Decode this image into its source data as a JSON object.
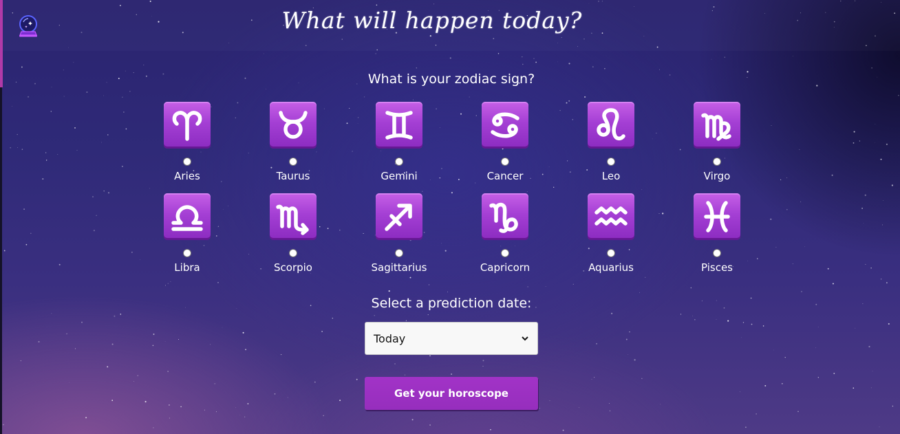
{
  "header": {
    "title": "What will happen today?",
    "logo_icon": "crystal-ball-icon"
  },
  "zodiac": {
    "question": "What is your zodiac sign?",
    "signs": [
      {
        "label": "Aries",
        "icon": "aries-icon",
        "glyph": "aries"
      },
      {
        "label": "Taurus",
        "icon": "taurus-icon",
        "glyph": "taurus"
      },
      {
        "label": "Gemini",
        "icon": "gemini-icon",
        "glyph": "gemini"
      },
      {
        "label": "Cancer",
        "icon": "cancer-icon",
        "glyph": "cancer"
      },
      {
        "label": "Leo",
        "icon": "leo-icon",
        "glyph": "leo"
      },
      {
        "label": "Virgo",
        "icon": "virgo-icon",
        "glyph": "virgo"
      },
      {
        "label": "Libra",
        "icon": "libra-icon",
        "glyph": "libra"
      },
      {
        "label": "Scorpio",
        "icon": "scorpio-icon",
        "glyph": "scorpio"
      },
      {
        "label": "Sagittarius",
        "icon": "sagittarius-icon",
        "glyph": "sagittarius"
      },
      {
        "label": "Capricorn",
        "icon": "capricorn-icon",
        "glyph": "capricorn"
      },
      {
        "label": "Aquarius",
        "icon": "aquarius-icon",
        "glyph": "aquarius"
      },
      {
        "label": "Pisces",
        "icon": "pisces-icon",
        "glyph": "pisces"
      }
    ]
  },
  "prediction": {
    "label": "Select a prediction date:",
    "selected": "Today"
  },
  "submit": {
    "label": "Get your horoscope"
  },
  "colors": {
    "tile": "#a43fd4",
    "button": "#9a2fc1",
    "accent": "#b03aa8"
  }
}
